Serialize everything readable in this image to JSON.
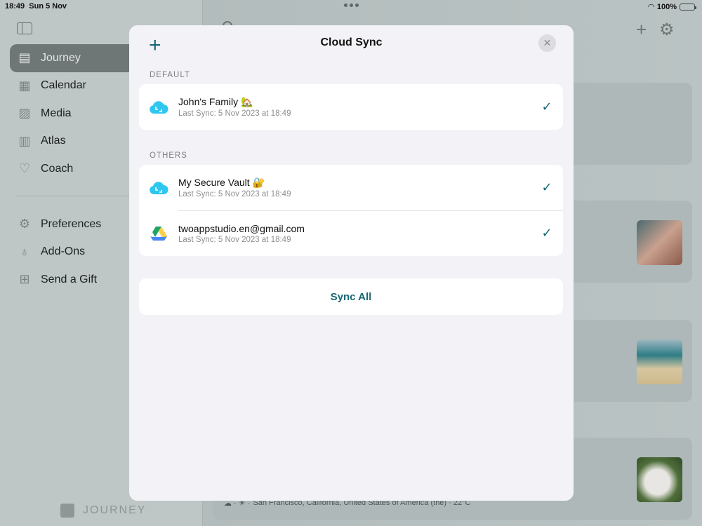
{
  "status_bar": {
    "time": "18:49",
    "date": "Sun 5 Nov",
    "battery": "100%",
    "battery_level": 1.0
  },
  "sidebar": {
    "items": [
      {
        "label": "Journey",
        "icon": "journal-icon",
        "active": true
      },
      {
        "label": "Calendar",
        "icon": "calendar-icon",
        "active": false
      },
      {
        "label": "Media",
        "icon": "photo-icon",
        "active": false
      },
      {
        "label": "Atlas",
        "icon": "map-icon",
        "active": false
      },
      {
        "label": "Coach",
        "icon": "heart-icon",
        "active": false
      }
    ],
    "lower_items": [
      {
        "label": "Preferences",
        "icon": "gear-icon"
      },
      {
        "label": "Add-Ons",
        "icon": "award-icon"
      },
      {
        "label": "Send a Gift",
        "icon": "gift-icon"
      }
    ],
    "brand": "JOURNEY"
  },
  "main": {
    "entry_location": "San Francisco, California, United States of America (the) · 22°C"
  },
  "modal": {
    "title": "Cloud Sync",
    "default_label": "DEFAULT",
    "others_label": "OTHERS",
    "default_accounts": [
      {
        "name": "John's Family 🏡",
        "sub": "Last Sync: 5 Nov 2023 at 18:49",
        "icon": "journey-cloud-icon",
        "checked": true
      }
    ],
    "other_accounts": [
      {
        "name": "My Secure Vault 🔐",
        "sub": "Last Sync: 5 Nov 2023 at 18:49",
        "icon": "journey-cloud-icon",
        "checked": true
      },
      {
        "name": "twoappstudio.en@gmail.com",
        "sub": "Last Sync: 5 Nov 2023 at 18:49",
        "icon": "google-drive-icon",
        "checked": true
      }
    ],
    "sync_all_label": "Sync All",
    "accent": "#176675"
  }
}
